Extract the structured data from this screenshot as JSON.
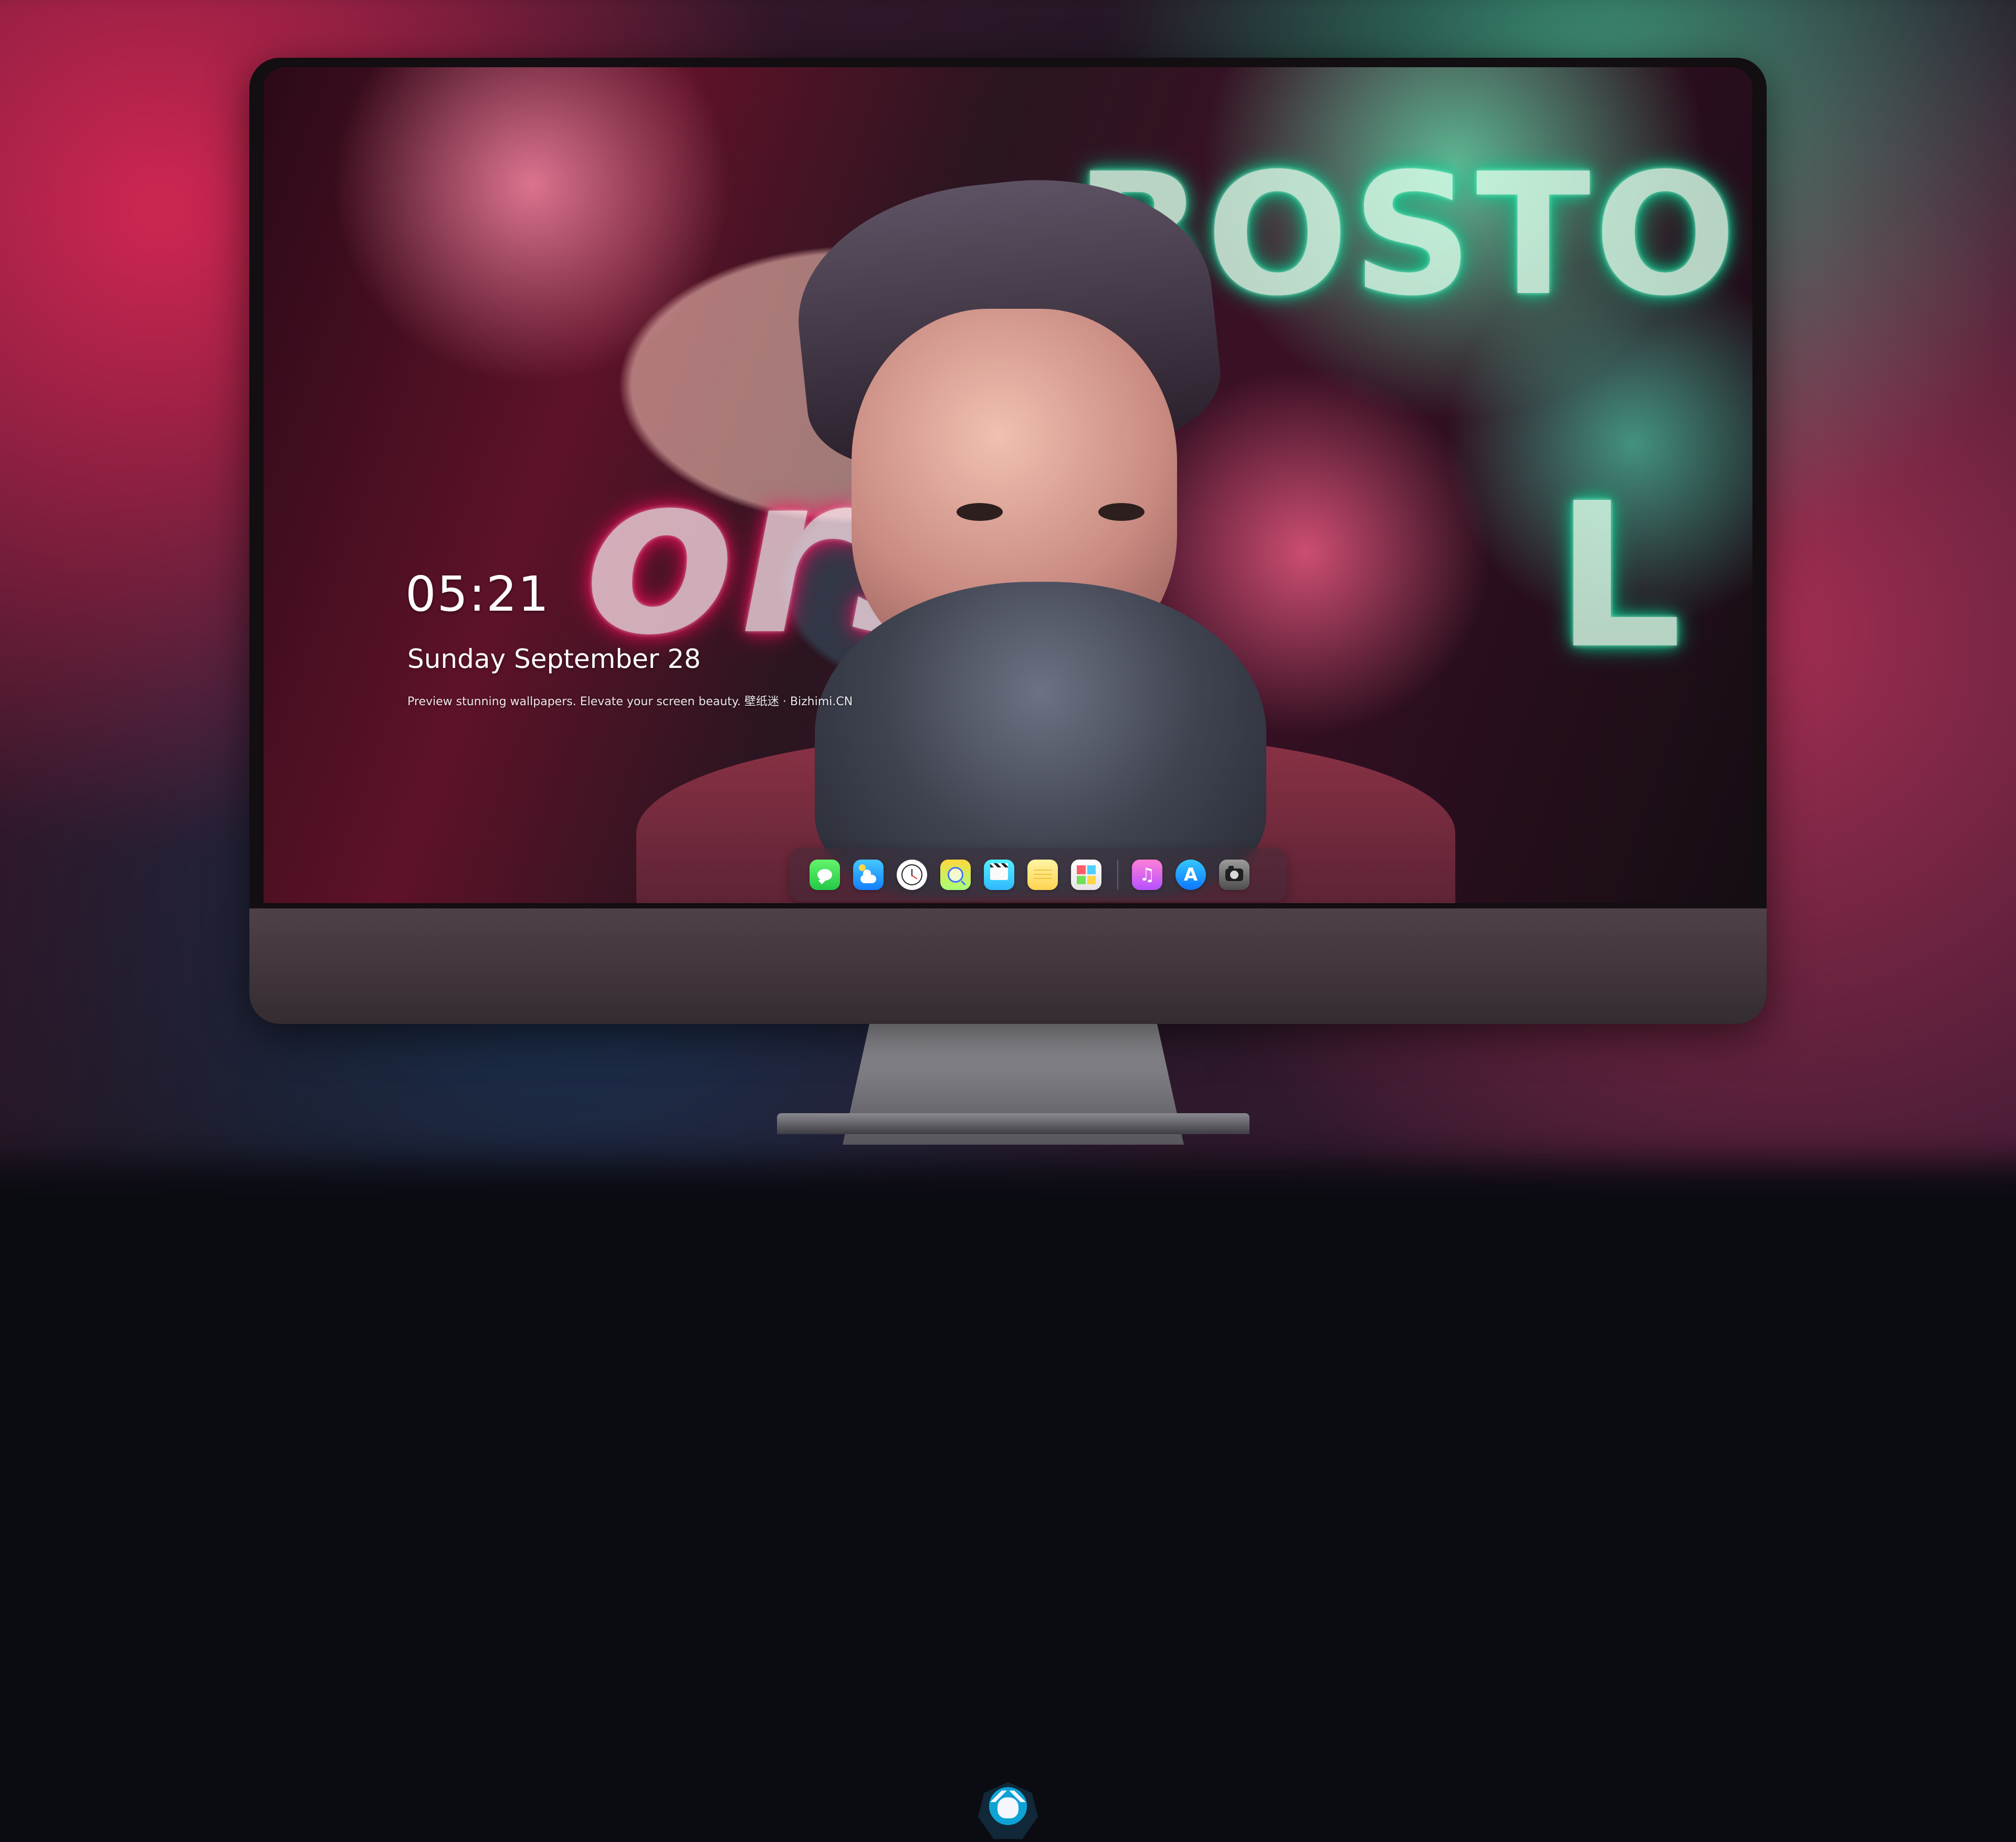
{
  "lockscreen": {
    "time": "05:21",
    "date": "Sunday September 28",
    "caption": "Preview stunning wallpapers. Elevate your screen beauty. 壁纸迷 · Bizhimi.CN"
  },
  "wallpaper": {
    "neon_texts": [
      "BOSTO",
      "ors",
      "L"
    ]
  },
  "dock": {
    "items": [
      {
        "icon": "messages-icon"
      },
      {
        "icon": "weather-icon"
      },
      {
        "icon": "clock-icon"
      },
      {
        "icon": "preview-icon"
      },
      {
        "icon": "clips-icon"
      },
      {
        "icon": "notes-icon"
      },
      {
        "icon": "photos-icon"
      },
      {
        "icon": "music-icon"
      },
      {
        "icon": "app-store-icon"
      },
      {
        "icon": "camera-icon"
      }
    ]
  },
  "brand": {
    "logo_icon": "mascot-logo-icon"
  }
}
